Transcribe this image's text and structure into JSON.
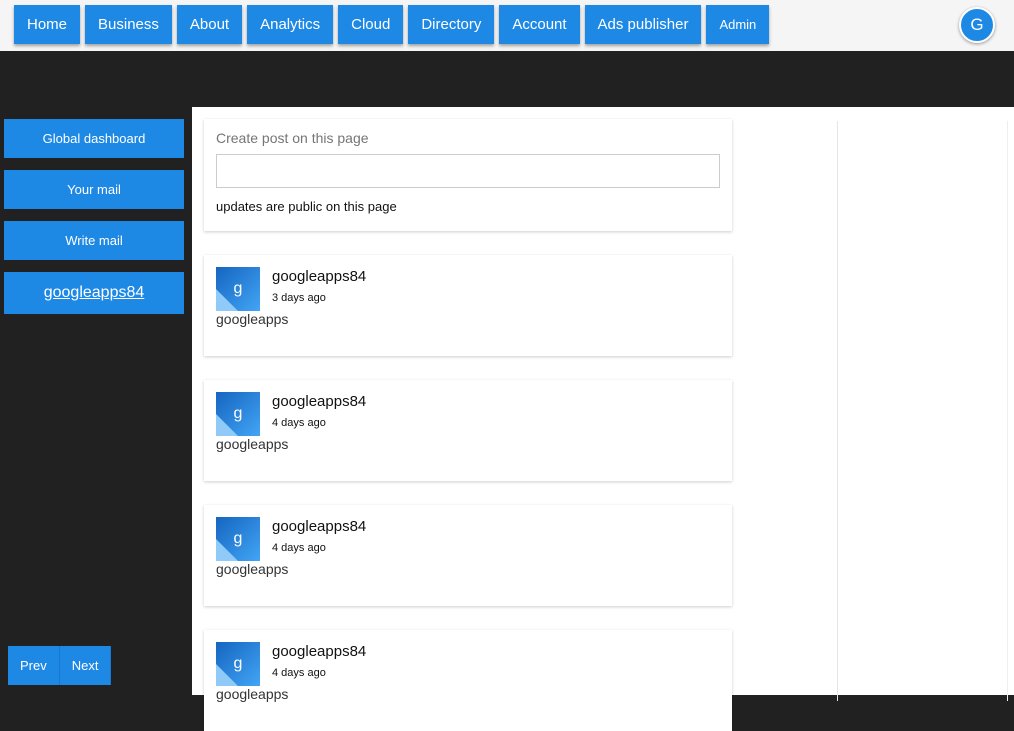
{
  "nav": {
    "items": [
      "Home",
      "Business",
      "About",
      "Analytics",
      "Cloud",
      "Directory",
      "Account",
      "Ads publisher",
      "Admin"
    ],
    "avatar": "G"
  },
  "sidebar": {
    "items": [
      "Global dashboard",
      "Your mail",
      "Write mail"
    ],
    "user": "googleapps84"
  },
  "pager": {
    "prev": "Prev",
    "next": "Next"
  },
  "create": {
    "label": "Create post on this page",
    "value": "",
    "note": "updates are public on this page"
  },
  "posts": [
    {
      "initial": "g",
      "author": "googleapps84",
      "time": "3 days ago",
      "body": "googleapps"
    },
    {
      "initial": "g",
      "author": "googleapps84",
      "time": "4 days ago",
      "body": "googleapps"
    },
    {
      "initial": "g",
      "author": "googleapps84",
      "time": "4 days ago",
      "body": "googleapps"
    },
    {
      "initial": "g",
      "author": "googleapps84",
      "time": "4 days ago",
      "body": "googleapps"
    }
  ]
}
